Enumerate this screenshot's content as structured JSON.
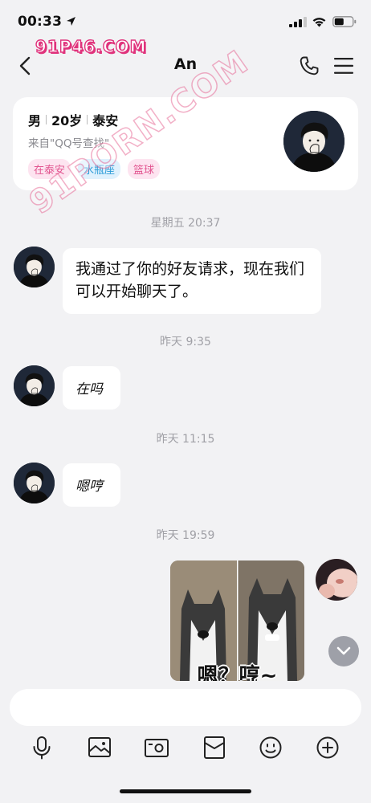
{
  "status_bar": {
    "time": "00:33"
  },
  "watermark": {
    "top": "91P46.COM",
    "diagonal": "91PORN.COM"
  },
  "nav": {
    "title": "An"
  },
  "profile": {
    "gender": "男",
    "age": "20岁",
    "city": "泰安",
    "source": "来自\"QQ号查找\"",
    "tags": [
      "在泰安",
      "水瓶座",
      "篮球"
    ]
  },
  "chat": {
    "timestamps": [
      "星期五 20:37",
      "昨天 9:35",
      "昨天 11:15",
      "昨天 19:59"
    ],
    "messages": [
      "我通过了你的好友请求，现在我们可以开始聊天了。",
      "在吗",
      "嗯哼"
    ],
    "sticker_caption": "嗯？哼~"
  },
  "input": {
    "placeholder": ""
  },
  "toolbar": {
    "icons": [
      "microphone-icon",
      "image-icon",
      "camera-icon",
      "red-packet-icon",
      "emoji-icon",
      "plus-icon"
    ]
  }
}
